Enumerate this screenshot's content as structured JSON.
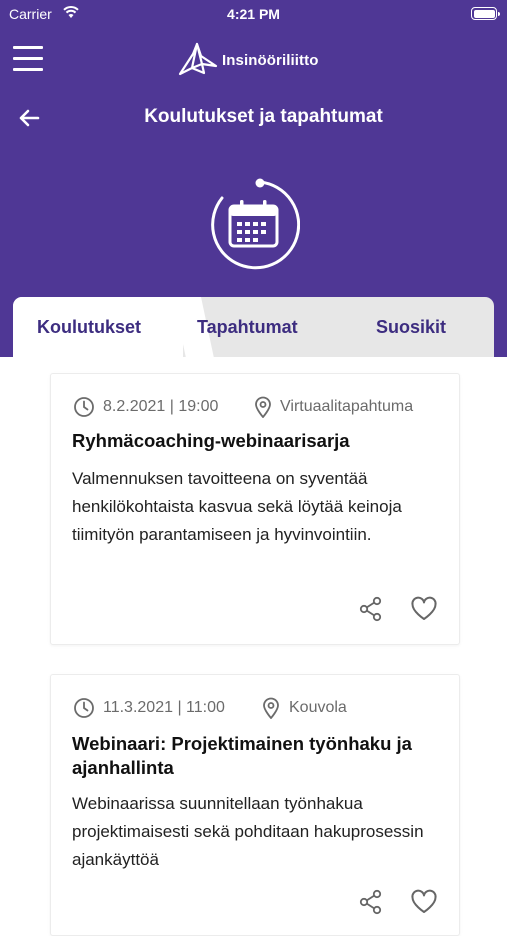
{
  "status_bar": {
    "carrier": "Carrier",
    "time": "4:21 PM"
  },
  "header": {
    "logo_text": "Insinööriliitto",
    "title": "Koulutukset ja tapahtumat"
  },
  "tabs": [
    {
      "label": "Koulutukset",
      "active": true
    },
    {
      "label": "Tapahtumat",
      "active": false
    },
    {
      "label": "Suosikit",
      "active": false
    }
  ],
  "events": [
    {
      "datetime": "8.2.2021 | 19:00",
      "location": "Virtuaalitapahtuma",
      "title": "Ryhmäcoaching-webinaarisarja",
      "description": "Valmennuksen tavoitteena on syventää henkilökohtaista kasvua sekä löytää keinoja tiimityön parantamiseen ja hyvinvointiin."
    },
    {
      "datetime": "11.3.2021 | 11:00",
      "location": "Kouvola",
      "title": "Webinaari: Projektimainen työnhaku ja ajanhallinta",
      "description": "Webinaarissa suunnitellaan työnhakua projektimaisesti sekä pohditaan hakuprosessin ajankäyttöä"
    }
  ],
  "colors": {
    "brand_purple": "#4f3795",
    "tab_text": "#3d2d80",
    "tab_inactive_bg": "#e7e7e7"
  },
  "icons": [
    "menu-icon",
    "back-arrow-icon",
    "calendar-icon",
    "clock-icon",
    "location-pin-icon",
    "share-icon",
    "heart-icon"
  ]
}
